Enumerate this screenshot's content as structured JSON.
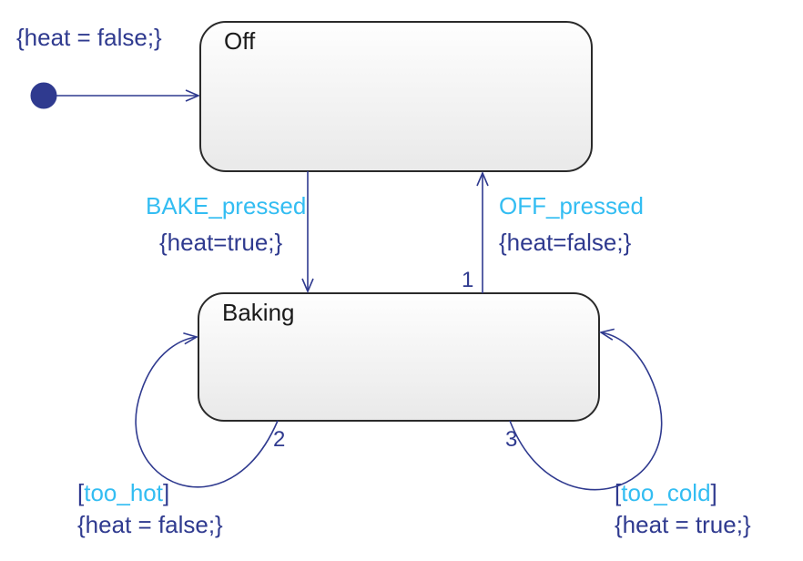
{
  "diagram": {
    "type": "state_chart",
    "states": {
      "off": {
        "label": "Off"
      },
      "baking": {
        "label": "Baking"
      }
    },
    "initial": {
      "action": "{heat = false;}"
    },
    "transitions": {
      "bake": {
        "event": "BAKE_pressed",
        "action": "{heat=true;}"
      },
      "off": {
        "event": "OFF_pressed",
        "action": "{heat=false;}",
        "priority": "1"
      },
      "too_hot": {
        "guard": "too_hot",
        "action": "{heat = false;}",
        "priority": "2"
      },
      "too_cold": {
        "guard": "too_cold",
        "action": "{heat = true;}",
        "priority": "3"
      }
    }
  }
}
